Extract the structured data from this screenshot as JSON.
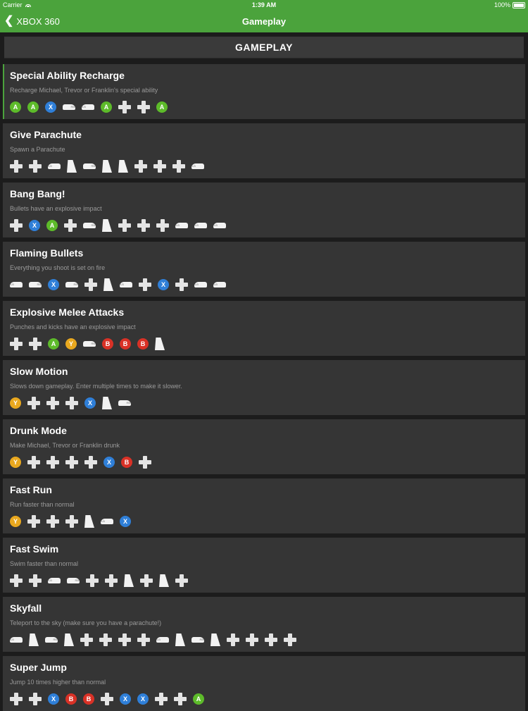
{
  "status": {
    "carrier": "Carrier",
    "time": "1:39 AM",
    "battery": "100%"
  },
  "nav": {
    "back": "XBOX 360",
    "title": "Gameplay"
  },
  "section": {
    "title": "GAMEPLAY"
  },
  "cheats": [
    {
      "name": "Special Ability Recharge",
      "desc": "Recharge Michael, Trevor or Franklin's special ability",
      "buttons": [
        "A",
        "A",
        "X",
        "RB",
        "LB",
        "A",
        "dpad",
        "dpad",
        "A"
      ]
    },
    {
      "name": "Give Parachute",
      "desc": "Spawn a Parachute",
      "buttons": [
        "dpad",
        "dpad",
        "LB",
        "LT",
        "RB",
        "RT",
        "RT",
        "dpad",
        "dpad",
        "dpad",
        "LB"
      ]
    },
    {
      "name": "Bang Bang!",
      "desc": "Bullets have an explosive impact",
      "buttons": [
        "dpad",
        "X",
        "A",
        "dpad",
        "RB",
        "RT",
        "dpad",
        "dpad",
        "dpad",
        "LB",
        "LB",
        "LB"
      ]
    },
    {
      "name": "Flaming Bullets",
      "desc": "Everything you shoot is set on fire",
      "buttons": [
        "LB",
        "RB",
        "X",
        "RB",
        "dpad",
        "RT",
        "LB",
        "dpad",
        "X",
        "dpad",
        "LB",
        "LB"
      ]
    },
    {
      "name": "Explosive Melee Attacks",
      "desc": "Punches and kicks have an explosive impact",
      "buttons": [
        "dpad",
        "dpad",
        "A",
        "Y",
        "RB",
        "B",
        "B",
        "B",
        "LT"
      ]
    },
    {
      "name": "Slow Motion",
      "desc": "Slows down gameplay. Enter multiple times to make it slower.",
      "buttons": [
        "Y",
        "dpad",
        "dpad",
        "dpad",
        "X",
        "RT",
        "RB"
      ]
    },
    {
      "name": "Drunk Mode",
      "desc": "Make Michael, Trevor or Franklin drunk",
      "buttons": [
        "Y",
        "dpad",
        "dpad",
        "dpad",
        "dpad",
        "X",
        "B",
        "dpad"
      ]
    },
    {
      "name": "Fast Run",
      "desc": "Run faster than normal",
      "buttons": [
        "Y",
        "dpad",
        "dpad",
        "dpad",
        "LT",
        "LB",
        "X"
      ]
    },
    {
      "name": "Fast Swim",
      "desc": "Swim faster than normal",
      "buttons": [
        "dpad",
        "dpad",
        "LB",
        "RB",
        "dpad",
        "dpad",
        "RT",
        "dpad",
        "LT",
        "dpad"
      ]
    },
    {
      "name": "Skyfall",
      "desc": "Teleport to the sky (make sure you have a parachute!)",
      "buttons": [
        "LB",
        "LT",
        "RB",
        "RT",
        "dpad",
        "dpad",
        "dpad",
        "dpad",
        "LB",
        "LT",
        "RB",
        "RT",
        "dpad",
        "dpad",
        "dpad",
        "dpad"
      ]
    },
    {
      "name": "Super Jump",
      "desc": "Jump 10 times higher than normal",
      "buttons": [
        "dpad",
        "dpad",
        "X",
        "B",
        "B",
        "dpad",
        "X",
        "X",
        "dpad",
        "dpad",
        "A"
      ]
    }
  ]
}
